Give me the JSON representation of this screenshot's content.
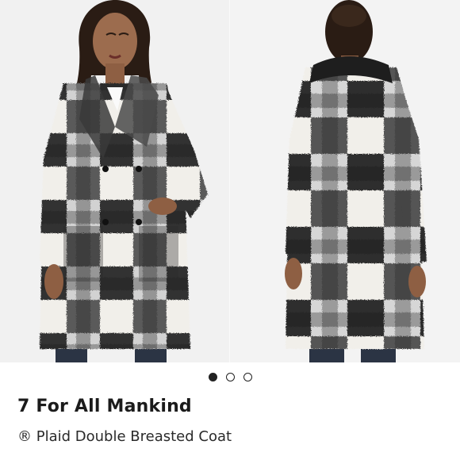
{
  "listing": {
    "brand": "7 For All Mankind",
    "title": "® Plaid Double Breasted Coat"
  },
  "gallery": {
    "photo_count": 3,
    "active_index": 0,
    "photo_alt_front": "Woman wearing plaid double breasted coat, front view",
    "photo_alt_back": "Woman wearing plaid double breasted coat, back view"
  },
  "colors": {
    "plaid_dark": "#1e1e1e",
    "plaid_mid": "#6b6b6b",
    "plaid_light": "#b9b9b9",
    "plaid_white": "#f2f0ec",
    "background": "#f1f1f1",
    "text": "#1b1b1b"
  },
  "icons": {
    "carousel_dot": "dot-icon"
  }
}
